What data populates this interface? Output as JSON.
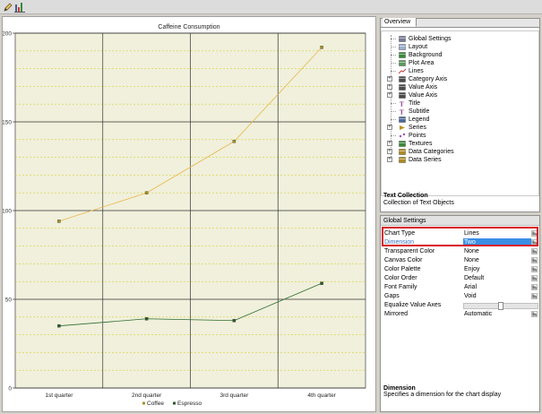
{
  "toolbar": {
    "buttons": [
      {
        "icon": "edit-icon"
      },
      {
        "icon": "chart-type-icon"
      }
    ]
  },
  "chart_data": {
    "type": "line",
    "title": "Caffeine Consumption",
    "categories": [
      "1st quarter",
      "2nd quarter",
      "3rd quarter",
      "4th quarter"
    ],
    "series": [
      {
        "name": "Coffee",
        "values": [
          94,
          110,
          139,
          192
        ],
        "color": "#e8b84a",
        "marker": "#a8922a"
      },
      {
        "name": "Espresso",
        "values": [
          35,
          39,
          38,
          59
        ],
        "color": "#2e6b2e",
        "marker": "#2e5a2e"
      }
    ],
    "yticks": [
      0,
      50,
      100,
      150,
      200
    ],
    "ylim": [
      0,
      200
    ],
    "grid": true,
    "legend": "bottom",
    "plot_background": "#f0f0dc"
  },
  "overview": {
    "tab_label": "Overview",
    "tree": [
      {
        "label": "Global Settings",
        "icon": "global-settings-icon",
        "expandable": false
      },
      {
        "label": "Layout",
        "icon": "layout-icon",
        "expandable": false
      },
      {
        "label": "Background",
        "icon": "background-icon",
        "expandable": false
      },
      {
        "label": "Plot Area",
        "icon": "plot-area-icon",
        "expandable": false
      },
      {
        "label": "Lines",
        "icon": "lines-icon",
        "expandable": false
      },
      {
        "label": "Category Axis",
        "icon": "category-axis-icon",
        "expandable": true
      },
      {
        "label": "Value Axis",
        "icon": "value-axis-icon",
        "expandable": true
      },
      {
        "label": "Value Axis",
        "icon": "value-axis-icon",
        "expandable": true
      },
      {
        "label": "Title",
        "icon": "title-icon",
        "expandable": false
      },
      {
        "label": "Subtitle",
        "icon": "subtitle-icon",
        "expandable": false
      },
      {
        "label": "Legend",
        "icon": "legend-icon",
        "expandable": false
      },
      {
        "label": "Series",
        "icon": "series-icon",
        "expandable": true
      },
      {
        "label": "Points",
        "icon": "points-icon",
        "expandable": false
      },
      {
        "label": "Textures",
        "icon": "textures-icon",
        "expandable": true
      },
      {
        "label": "Data Categories",
        "icon": "data-categories-icon",
        "expandable": true
      },
      {
        "label": "Data Series",
        "icon": "data-series-icon",
        "expandable": true
      }
    ],
    "description_title": "Text Collection",
    "description_text": "Collection of Text Objects"
  },
  "settings": {
    "header": "Global Settings",
    "properties": [
      {
        "name": "Chart Type",
        "value": "Lines",
        "button": true
      },
      {
        "name": "Dimension",
        "value": "Two",
        "button": true,
        "selected": true
      },
      {
        "name": "Transparent Color",
        "value": "None",
        "button": true
      },
      {
        "name": "Canvas Color",
        "value": "None",
        "button": true
      },
      {
        "name": "Color Palette",
        "value": "Enjoy",
        "button": true
      },
      {
        "name": "Color Order",
        "value": "Default",
        "button": true
      },
      {
        "name": "Font Family",
        "value": "Arial",
        "button": true
      },
      {
        "name": "Gaps",
        "value": "Void",
        "button": true
      },
      {
        "name": "Equalize Value Axes",
        "value": "",
        "slider": true
      },
      {
        "name": "Mirrored",
        "value": "Automatic",
        "button": true
      }
    ],
    "description_title": "Dimension",
    "description_text": "Specifies a dimension for the chart display"
  },
  "colors": {
    "highlight": "#d8141d",
    "selection": "#3a8ee6",
    "dimension_label": "#3a74c4"
  }
}
